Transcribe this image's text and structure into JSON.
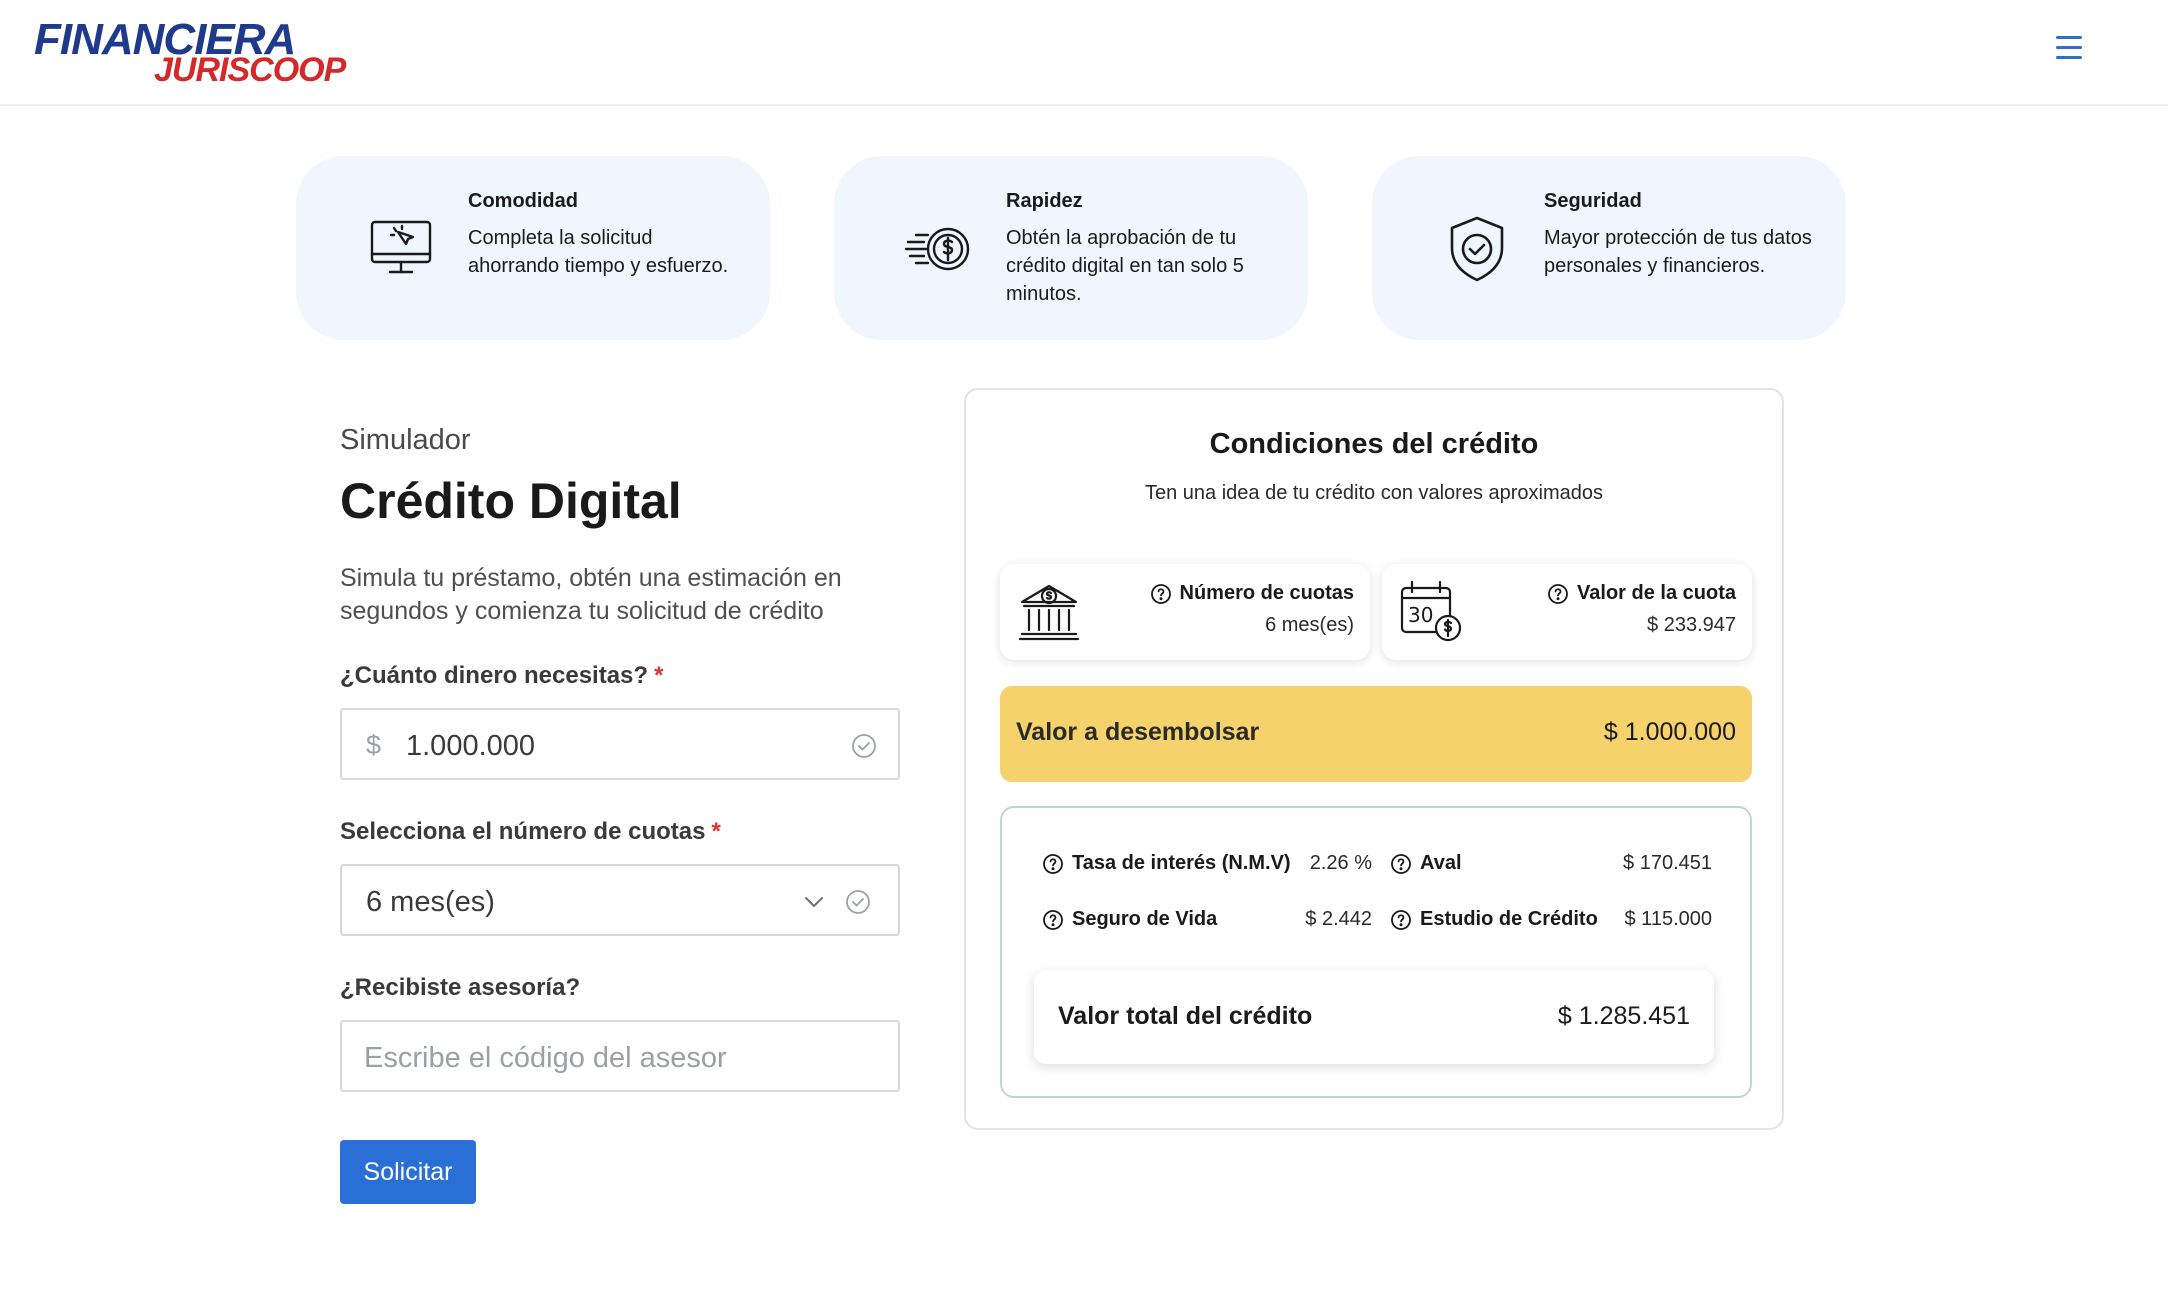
{
  "brand": {
    "line1": "FINANCIERA",
    "line2": "JURISCOOP"
  },
  "features": [
    {
      "title": "Comodidad",
      "text": "Completa la solicitud ahorrando tiempo y esfuerzo.",
      "icon": "monitor-click-icon"
    },
    {
      "title": "Rapidez",
      "text": "Obtén la aprobación de tu crédito digital en tan solo 5 minutos.",
      "icon": "fast-coin-icon"
    },
    {
      "title": "Seguridad",
      "text": "Mayor protección de tus datos personales y financieros.",
      "icon": "shield-check-icon"
    }
  ],
  "simulator": {
    "eyebrow": "Simulador",
    "title": "Crédito Digital",
    "lead": "Simula tu préstamo, obtén una estimación en segundos y comienza tu solicitud de crédito",
    "amount_label": "¿Cuánto dinero necesitas?",
    "required_mark": "*",
    "currency_prefix": "$",
    "amount_value": "1.000.000",
    "installments_label": "Selecciona el número de cuotas",
    "installments_value": "6 mes(es)",
    "advisor_label": "¿Recibiste asesoría?",
    "advisor_placeholder": "Escribe el código del asesor",
    "submit_label": "Solicitar"
  },
  "conditions": {
    "title": "Condiciones del crédito",
    "subtitle": "Ten una idea de tu crédito con valores aproximados",
    "installments_count_label": "Número de cuotas",
    "installments_count_value": "6 mes(es)",
    "installment_value_label": "Valor de la cuota",
    "installment_value": "$ 233.947",
    "disburse_label": "Valor a desembolsar",
    "disburse_value": "$ 1.000.000",
    "rate_label": "Tasa de interés (N.M.V)",
    "rate_value": "2.26 %",
    "aval_label": "Aval",
    "aval_value": "$ 170.451",
    "insurance_label": "Seguro de Vida",
    "insurance_value": "$ 2.442",
    "study_label": "Estudio de Crédito",
    "study_value": "$ 115.000",
    "total_label": "Valor total del crédito",
    "total_value": "$ 1.285.451"
  },
  "colors": {
    "primary": "#2a6fd6",
    "highlight": "#f5d26b",
    "feature_bg": "#eff6fd",
    "brand_blue": "#1f3a8a",
    "brand_red": "#d62828"
  }
}
